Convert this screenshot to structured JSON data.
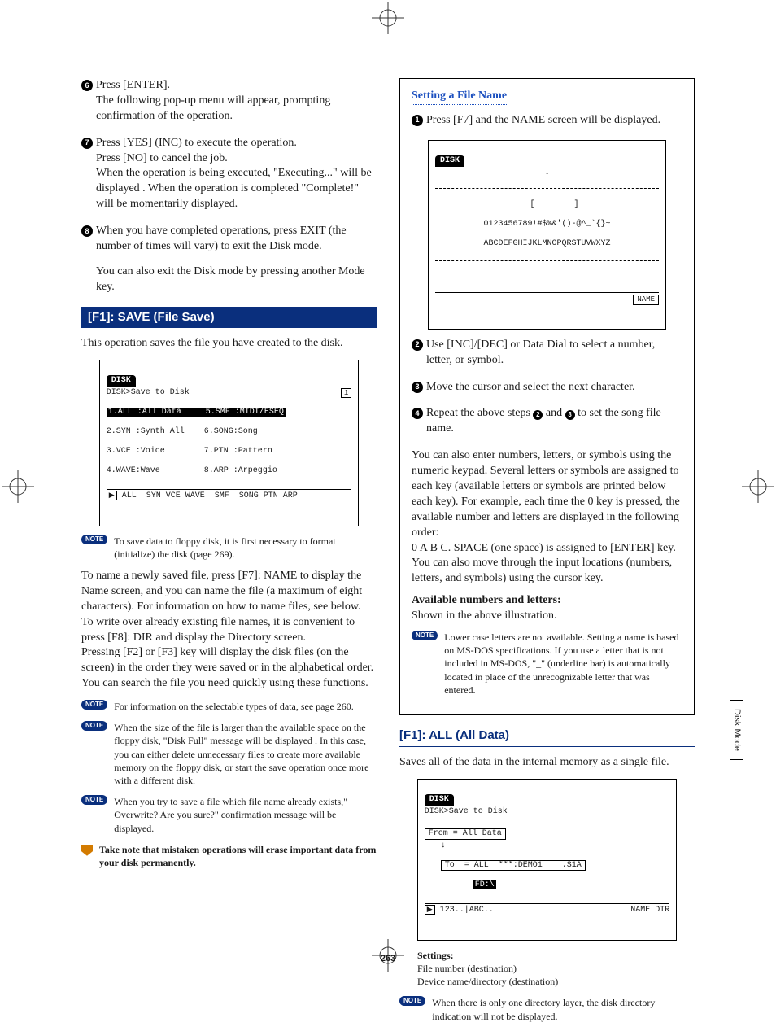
{
  "page_number": "263",
  "side_tab": "Disk Mode",
  "left": {
    "step6": {
      "num": "6",
      "line1": "Press [ENTER].",
      "line2": "The following pop-up menu will appear, prompting confirmation of the operation."
    },
    "step7": {
      "num": "7",
      "line1": "Press [YES] (INC) to execute the operation.",
      "line2": "Press [NO] to cancel the job.",
      "line3": "When the operation is being executed, \"Executing...\" will be displayed . When the operation is completed \"Complete!\" will be momentarily displayed."
    },
    "step8": {
      "num": "8",
      "line1": "When you have completed operations, press EXIT (the number of times will vary) to exit the Disk mode.",
      "line2": "You can also exit the Disk mode by pressing another Mode key."
    },
    "save_bar": "[F1]: SAVE (File Save)",
    "save_intro": "This operation saves the file you have created to the disk.",
    "lcd_save": {
      "tab": "DISK",
      "title": "DISK>Save to Disk",
      "title_right": "1",
      "rows": [
        "1.ALL :All Data     5.SMF :MIDI/ESEQ",
        "2.SYN :Synth All    6.SONG:Song",
        "3.VCE :Voice        7.PTN :Pattern",
        "4.WAVE:Wave         8.ARP :Arpeggio"
      ],
      "footer": "ALL  SYN VCE WAVE  SMF  SONG PTN ARP"
    },
    "note1": "To save data to floppy disk, it is first necessary to format (initialize) the disk (page 269).",
    "para1": "To name a newly saved file, press [F7]: NAME to display the Name screen, and you can name the file (a maximum of eight characters). For information on how to name files, see below.",
    "para2": "To write over already existing file names, it is convenient to press [F8]: DIR and display the Directory screen.",
    "para3": "Pressing [F2] or [F3] key will display the disk files (on the screen) in the order they were saved or in the alphabetical order. You can search the file you need quickly using these functions.",
    "note2": "For information on the selectable types of data, see page 260.",
    "note3": "When the size of the file is larger than the available space on the floppy disk, \"Disk Full\" message will be displayed . In this case, you can either delete unnecessary files to create more available memory on the floppy disk, or start the save operation once more with a different disk.",
    "note4": "When you try to save a file which file name already exists,\" Overwrite? Are you sure?\" confirmation message will be displayed.",
    "warn": "Take note that mistaken operations will erase important data from your disk permanently."
  },
  "right": {
    "box": {
      "title": "Setting a File Name",
      "s1": {
        "num": "1",
        "text": "Press [F7] and the NAME screen will be displayed."
      },
      "lcd_name": {
        "tab": "DISK",
        "line1": "0123456789!#$%&'()-@^_`{}~",
        "line2": "ABCDEFGHIJKLMNOPQRSTUVWXYZ",
        "btn": "NAME"
      },
      "s2": {
        "num": "2",
        "text": "Use [INC]/[DEC] or Data Dial to select a number, letter, or symbol."
      },
      "s3": {
        "num": "3",
        "text": "Move the cursor and select the next character."
      },
      "s4": {
        "num": "4",
        "prefix": "Repeat the above steps ",
        "ref1": "2",
        "mid": " and ",
        "ref2": "3",
        "suffix": " to set the song file name."
      },
      "para1": "You can also enter numbers, letters, or symbols using the numeric keypad. Several letters or symbols are assigned to each key (available letters or symbols are printed below each key). For example, each time the 0 key is pressed, the available number and letters are displayed in the following order:",
      "para2": "0   A   B   C. SPACE (one space) is assigned to [ENTER] key. You can also move through the input locations (numbers, letters, and symbols) using the cursor key.",
      "avail_hd": "Available numbers and letters:",
      "avail_body": "Shown in the above illustration.",
      "note": "Lower case letters are not available. Setting a name is based on MS-DOS specifications. If you use a letter that is not included in MS-DOS, \"_\" (underline bar) is automatically located in place of the unrecognizable letter that was entered."
    },
    "all_bar": "[F1]: ALL (All Data)",
    "all_intro": "Saves all of the data in the internal memory as a single file.",
    "lcd_all": {
      "tab": "DISK",
      "title": "DISK>Save to Disk",
      "from": "From = All Data",
      "to": "To  = ALL  ***:DEMO1    .S1A",
      "fd": "FD:\\",
      "footer_left": "123..|ABC..",
      "footer_right": "NAME DIR"
    },
    "settings_hd": "Settings:",
    "settings_l1": "File number (destination)",
    "settings_l2": "Device name/directory (destination)",
    "note": "When there is only one directory layer, the disk directory indication will not be displayed."
  },
  "note_label": "NOTE"
}
